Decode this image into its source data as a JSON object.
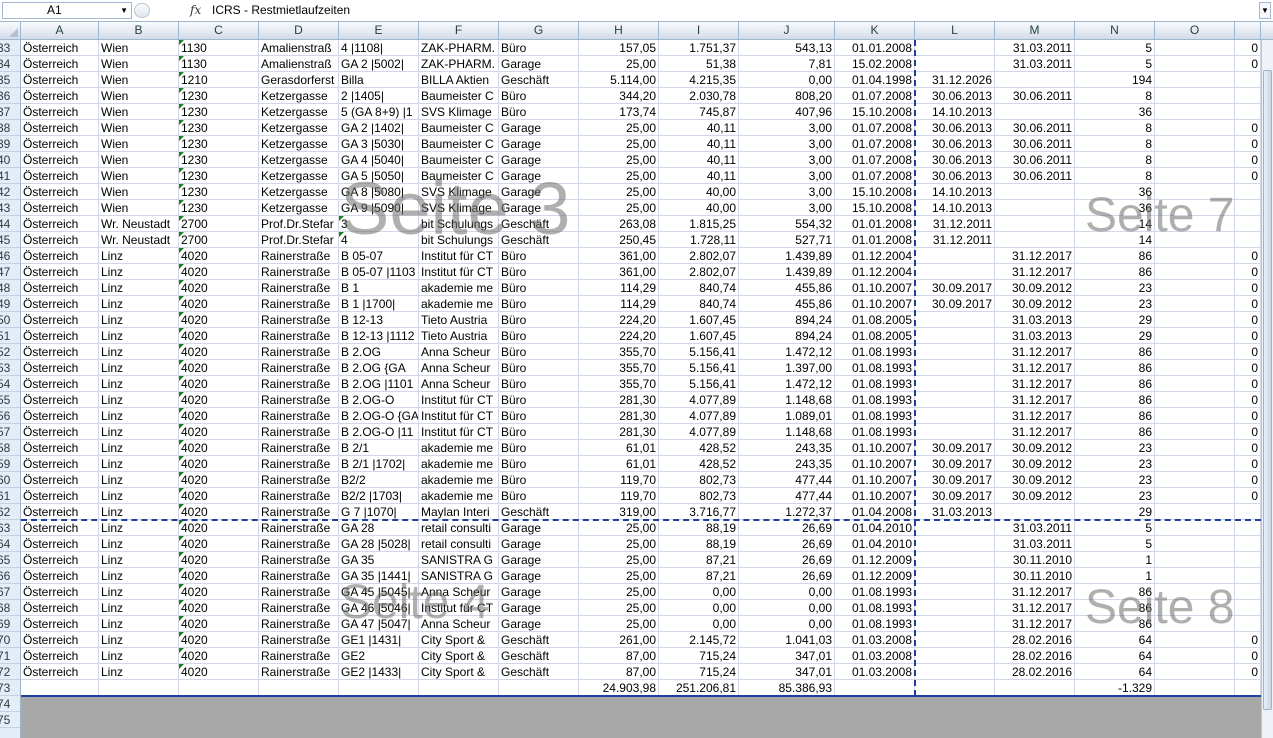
{
  "formula_bar": {
    "name_box": "A1",
    "fx_label": "fx",
    "formula": "ICRS - Restmietlaufzeiten"
  },
  "columns": [
    "A",
    "B",
    "C",
    "D",
    "E",
    "F",
    "G",
    "H",
    "I",
    "J",
    "K",
    "L",
    "M",
    "N",
    "O",
    ""
  ],
  "watermarks": {
    "page3": "Seite 3",
    "page4": "Seite 4",
    "page7": "Seite 7",
    "page8": "Seite 8"
  },
  "rows": [
    {
      "n": "33",
      "a": "Österreich",
      "b": "Wien",
      "c": "1130",
      "d": "Amalienstraß",
      "e": "4 |1108|",
      "f": "ZAK-PHARM.",
      "g": "Büro",
      "h": "157,05",
      "i": "1.751,37",
      "j": "543,13",
      "k": "01.01.2008",
      "l": "",
      "m": "31.03.2011",
      "nn": "5",
      "o": "",
      "p": "0"
    },
    {
      "n": "34",
      "a": "Österreich",
      "b": "Wien",
      "c": "1130",
      "d": "Amalienstraß",
      "e": "GA 2 |5002|",
      "f": "ZAK-PHARM.",
      "g": "Garage",
      "h": "25,00",
      "i": "51,38",
      "j": "7,81",
      "k": "15.02.2008",
      "l": "",
      "m": "31.03.2011",
      "nn": "5",
      "o": "",
      "p": "0"
    },
    {
      "n": "35",
      "a": "Österreich",
      "b": "Wien",
      "c": "1210",
      "d": "Gerasdorferst",
      "e": "Billa",
      "f": "BILLA Aktien",
      "g": "Geschäft",
      "h": "5.114,00",
      "i": "4.215,35",
      "j": "0,00",
      "k": "01.04.1998",
      "l": "31.12.2026",
      "m": "",
      "nn": "194",
      "o": "",
      "p": ""
    },
    {
      "n": "36",
      "a": "Österreich",
      "b": "Wien",
      "c": "1230",
      "d": "Ketzergasse",
      "e": "2 |1405|",
      "f": "Baumeister C",
      "g": "Büro",
      "h": "344,20",
      "i": "2.030,78",
      "j": "808,20",
      "k": "01.07.2008",
      "l": "30.06.2013",
      "m": "30.06.2011",
      "nn": "8",
      "o": "",
      "p": ""
    },
    {
      "n": "37",
      "a": "Österreich",
      "b": "Wien",
      "c": "1230",
      "d": "Ketzergasse",
      "e": "5 (GA 8+9) |1",
      "f": "SVS Klimage",
      "g": "Büro",
      "h": "173,74",
      "i": "745,87",
      "j": "407,96",
      "k": "15.10.2008",
      "l": "14.10.2013",
      "m": "",
      "nn": "36",
      "o": "",
      "p": ""
    },
    {
      "n": "38",
      "a": "Österreich",
      "b": "Wien",
      "c": "1230",
      "d": "Ketzergasse",
      "e": "GA 2 |1402|",
      "f": "Baumeister C",
      "g": "Garage",
      "h": "25,00",
      "i": "40,11",
      "j": "3,00",
      "k": "01.07.2008",
      "l": "30.06.2013",
      "m": "30.06.2011",
      "nn": "8",
      "o": "",
      "p": "0"
    },
    {
      "n": "39",
      "a": "Österreich",
      "b": "Wien",
      "c": "1230",
      "d": "Ketzergasse",
      "e": "GA 3 |5030|",
      "f": "Baumeister C",
      "g": "Garage",
      "h": "25,00",
      "i": "40,11",
      "j": "3,00",
      "k": "01.07.2008",
      "l": "30.06.2013",
      "m": "30.06.2011",
      "nn": "8",
      "o": "",
      "p": "0"
    },
    {
      "n": "40",
      "a": "Österreich",
      "b": "Wien",
      "c": "1230",
      "d": "Ketzergasse",
      "e": "GA 4 |5040|",
      "f": "Baumeister C",
      "g": "Garage",
      "h": "25,00",
      "i": "40,11",
      "j": "3,00",
      "k": "01.07.2008",
      "l": "30.06.2013",
      "m": "30.06.2011",
      "nn": "8",
      "o": "",
      "p": "0"
    },
    {
      "n": "41",
      "a": "Österreich",
      "b": "Wien",
      "c": "1230",
      "d": "Ketzergasse",
      "e": "GA 5 |5050|",
      "f": "Baumeister C",
      "g": "Garage",
      "h": "25,00",
      "i": "40,11",
      "j": "3,00",
      "k": "01.07.2008",
      "l": "30.06.2013",
      "m": "30.06.2011",
      "nn": "8",
      "o": "",
      "p": "0"
    },
    {
      "n": "42",
      "a": "Österreich",
      "b": "Wien",
      "c": "1230",
      "d": "Ketzergasse",
      "e": "GA 8 |5080|",
      "f": "SVS Klimage",
      "g": "Garage",
      "h": "25,00",
      "i": "40,00",
      "j": "3,00",
      "k": "15.10.2008",
      "l": "14.10.2013",
      "m": "",
      "nn": "36",
      "o": "",
      "p": ""
    },
    {
      "n": "43",
      "a": "Österreich",
      "b": "Wien",
      "c": "1230",
      "d": "Ketzergasse",
      "e": "GA 9 |5090|",
      "f": "SVS Klimage",
      "g": "Garage",
      "h": "25,00",
      "i": "40,00",
      "j": "3,00",
      "k": "15.10.2008",
      "l": "14.10.2013",
      "m": "",
      "nn": "36",
      "o": "",
      "p": ""
    },
    {
      "n": "44",
      "a": "Österreich",
      "b": "Wr. Neustadt",
      "c": "2700",
      "d": "Prof.Dr.Stefar",
      "e": "3",
      "f": "bit Schulungs",
      "g": "Geschäft",
      "h": "263,08",
      "i": "1.815,25",
      "j": "554,32",
      "k": "01.01.2008",
      "l": "31.12.2011",
      "m": "",
      "nn": "14",
      "o": "",
      "p": ""
    },
    {
      "n": "45",
      "a": "Österreich",
      "b": "Wr. Neustadt",
      "c": "2700",
      "d": "Prof.Dr.Stefar",
      "e": "4",
      "f": "bit Schulungs",
      "g": "Geschäft",
      "h": "250,45",
      "i": "1.728,11",
      "j": "527,71",
      "k": "01.01.2008",
      "l": "31.12.2011",
      "m": "",
      "nn": "14",
      "o": "",
      "p": ""
    },
    {
      "n": "46",
      "a": "Österreich",
      "b": "Linz",
      "c": "4020",
      "d": "Rainerstraße",
      "e": "B 05-07",
      "f": "Institut für CT",
      "g": "Büro",
      "h": "361,00",
      "i": "2.802,07",
      "j": "1.439,89",
      "k": "01.12.2004",
      "l": "",
      "m": "31.12.2017",
      "nn": "86",
      "o": "",
      "p": "0"
    },
    {
      "n": "47",
      "a": "Österreich",
      "b": "Linz",
      "c": "4020",
      "d": "Rainerstraße",
      "e": "B 05-07 |1103",
      "f": "Institut für CT",
      "g": "Büro",
      "h": "361,00",
      "i": "2.802,07",
      "j": "1.439,89",
      "k": "01.12.2004",
      "l": "",
      "m": "31.12.2017",
      "nn": "86",
      "o": "",
      "p": "0"
    },
    {
      "n": "48",
      "a": "Österreich",
      "b": "Linz",
      "c": "4020",
      "d": "Rainerstraße",
      "e": "B 1",
      "f": "akademie me",
      "g": "Büro",
      "h": "114,29",
      "i": "840,74",
      "j": "455,86",
      "k": "01.10.2007",
      "l": "30.09.2017",
      "m": "30.09.2012",
      "nn": "23",
      "o": "",
      "p": "0"
    },
    {
      "n": "49",
      "a": "Österreich",
      "b": "Linz",
      "c": "4020",
      "d": "Rainerstraße",
      "e": "B 1 |1700|",
      "f": "akademie me",
      "g": "Büro",
      "h": "114,29",
      "i": "840,74",
      "j": "455,86",
      "k": "01.10.2007",
      "l": "30.09.2017",
      "m": "30.09.2012",
      "nn": "23",
      "o": "",
      "p": "0"
    },
    {
      "n": "50",
      "a": "Österreich",
      "b": "Linz",
      "c": "4020",
      "d": "Rainerstraße",
      "e": "B 12-13",
      "f": "Tieto Austria",
      "g": "Büro",
      "h": "224,20",
      "i": "1.607,45",
      "j": "894,24",
      "k": "01.08.2005",
      "l": "",
      "m": "31.03.2013",
      "nn": "29",
      "o": "",
      "p": "0"
    },
    {
      "n": "51",
      "a": "Österreich",
      "b": "Linz",
      "c": "4020",
      "d": "Rainerstraße",
      "e": "B 12-13 |1112",
      "f": "Tieto Austria",
      "g": "Büro",
      "h": "224,20",
      "i": "1.607,45",
      "j": "894,24",
      "k": "01.08.2005",
      "l": "",
      "m": "31.03.2013",
      "nn": "29",
      "o": "",
      "p": "0"
    },
    {
      "n": "52",
      "a": "Österreich",
      "b": "Linz",
      "c": "4020",
      "d": "Rainerstraße",
      "e": "B 2.OG",
      "f": "Anna Scheur",
      "g": "Büro",
      "h": "355,70",
      "i": "5.156,41",
      "j": "1.472,12",
      "k": "01.08.1993",
      "l": "",
      "m": "31.12.2017",
      "nn": "86",
      "o": "",
      "p": "0"
    },
    {
      "n": "53",
      "a": "Österreich",
      "b": "Linz",
      "c": "4020",
      "d": "Rainerstraße",
      "e": "B 2.OG {GA",
      "f": "Anna Scheur",
      "g": "Büro",
      "h": "355,70",
      "i": "5.156,41",
      "j": "1.397,00",
      "k": "01.08.1993",
      "l": "",
      "m": "31.12.2017",
      "nn": "86",
      "o": "",
      "p": "0"
    },
    {
      "n": "54",
      "a": "Österreich",
      "b": "Linz",
      "c": "4020",
      "d": "Rainerstraße",
      "e": "B 2.OG |1101",
      "f": "Anna Scheur",
      "g": "Büro",
      "h": "355,70",
      "i": "5.156,41",
      "j": "1.472,12",
      "k": "01.08.1993",
      "l": "",
      "m": "31.12.2017",
      "nn": "86",
      "o": "",
      "p": "0"
    },
    {
      "n": "55",
      "a": "Österreich",
      "b": "Linz",
      "c": "4020",
      "d": "Rainerstraße",
      "e": "B 2.OG-O",
      "f": "Institut für CT",
      "g": "Büro",
      "h": "281,30",
      "i": "4.077,89",
      "j": "1.148,68",
      "k": "01.08.1993",
      "l": "",
      "m": "31.12.2017",
      "nn": "86",
      "o": "",
      "p": "0"
    },
    {
      "n": "56",
      "a": "Österreich",
      "b": "Linz",
      "c": "4020",
      "d": "Rainerstraße",
      "e": "B 2.OG-O {GA",
      "f": "Institut für CT",
      "g": "Büro",
      "h": "281,30",
      "i": "4.077,89",
      "j": "1.089,01",
      "k": "01.08.1993",
      "l": "",
      "m": "31.12.2017",
      "nn": "86",
      "o": "",
      "p": "0"
    },
    {
      "n": "57",
      "a": "Österreich",
      "b": "Linz",
      "c": "4020",
      "d": "Rainerstraße",
      "e": "B 2.OG-O |11",
      "f": "Institut für CT",
      "g": "Büro",
      "h": "281,30",
      "i": "4.077,89",
      "j": "1.148,68",
      "k": "01.08.1993",
      "l": "",
      "m": "31.12.2017",
      "nn": "86",
      "o": "",
      "p": "0"
    },
    {
      "n": "58",
      "a": "Österreich",
      "b": "Linz",
      "c": "4020",
      "d": "Rainerstraße",
      "e": "B 2/1",
      "f": "akademie me",
      "g": "Büro",
      "h": "61,01",
      "i": "428,52",
      "j": "243,35",
      "k": "01.10.2007",
      "l": "30.09.2017",
      "m": "30.09.2012",
      "nn": "23",
      "o": "",
      "p": "0"
    },
    {
      "n": "59",
      "a": "Österreich",
      "b": "Linz",
      "c": "4020",
      "d": "Rainerstraße",
      "e": "B 2/1 |1702|",
      "f": "akademie me",
      "g": "Büro",
      "h": "61,01",
      "i": "428,52",
      "j": "243,35",
      "k": "01.10.2007",
      "l": "30.09.2017",
      "m": "30.09.2012",
      "nn": "23",
      "o": "",
      "p": "0"
    },
    {
      "n": "60",
      "a": "Österreich",
      "b": "Linz",
      "c": "4020",
      "d": "Rainerstraße",
      "e": "B2/2",
      "f": "akademie me",
      "g": "Büro",
      "h": "119,70",
      "i": "802,73",
      "j": "477,44",
      "k": "01.10.2007",
      "l": "30.09.2017",
      "m": "30.09.2012",
      "nn": "23",
      "o": "",
      "p": "0"
    },
    {
      "n": "61",
      "a": "Österreich",
      "b": "Linz",
      "c": "4020",
      "d": "Rainerstraße",
      "e": "B2/2 |1703|",
      "f": "akademie me",
      "g": "Büro",
      "h": "119,70",
      "i": "802,73",
      "j": "477,44",
      "k": "01.10.2007",
      "l": "30.09.2017",
      "m": "30.09.2012",
      "nn": "23",
      "o": "",
      "p": "0"
    },
    {
      "n": "62",
      "a": "Österreich",
      "b": "Linz",
      "c": "4020",
      "d": "Rainerstraße",
      "e": "G 7 |1070|",
      "f": "Maylan Interi",
      "g": "Geschäft",
      "h": "319,00",
      "i": "3.716,77",
      "j": "1.272,37",
      "k": "01.04.2008",
      "l": "31.03.2013",
      "m": "",
      "nn": "29",
      "o": "",
      "p": ""
    },
    {
      "n": "63",
      "a": "Österreich",
      "b": "Linz",
      "c": "4020",
      "d": "Rainerstraße",
      "e": "GA 28",
      "f": "retail consulti",
      "g": "Garage",
      "h": "25,00",
      "i": "88,19",
      "j": "26,69",
      "k": "01.04.2010",
      "l": "",
      "m": "31.03.2011",
      "nn": "5",
      "o": "",
      "p": ""
    },
    {
      "n": "64",
      "a": "Österreich",
      "b": "Linz",
      "c": "4020",
      "d": "Rainerstraße",
      "e": "GA 28 |5028|",
      "f": "retail consulti",
      "g": "Garage",
      "h": "25,00",
      "i": "88,19",
      "j": "26,69",
      "k": "01.04.2010",
      "l": "",
      "m": "31.03.2011",
      "nn": "5",
      "o": "",
      "p": ""
    },
    {
      "n": "65",
      "a": "Österreich",
      "b": "Linz",
      "c": "4020",
      "d": "Rainerstraße",
      "e": "GA 35",
      "f": "SANISTRA G",
      "g": "Garage",
      "h": "25,00",
      "i": "87,21",
      "j": "26,69",
      "k": "01.12.2009",
      "l": "",
      "m": "30.11.2010",
      "nn": "1",
      "o": "",
      "p": ""
    },
    {
      "n": "66",
      "a": "Österreich",
      "b": "Linz",
      "c": "4020",
      "d": "Rainerstraße",
      "e": "GA 35 |1441|",
      "f": "SANISTRA G",
      "g": "Garage",
      "h": "25,00",
      "i": "87,21",
      "j": "26,69",
      "k": "01.12.2009",
      "l": "",
      "m": "30.11.2010",
      "nn": "1",
      "o": "",
      "p": ""
    },
    {
      "n": "67",
      "a": "Österreich",
      "b": "Linz",
      "c": "4020",
      "d": "Rainerstraße",
      "e": "GA 45 |5045|",
      "f": "Anna Scheur",
      "g": "Garage",
      "h": "25,00",
      "i": "0,00",
      "j": "0,00",
      "k": "01.08.1993",
      "l": "",
      "m": "31.12.2017",
      "nn": "86",
      "o": "",
      "p": ""
    },
    {
      "n": "68",
      "a": "Österreich",
      "b": "Linz",
      "c": "4020",
      "d": "Rainerstraße",
      "e": "GA 46 |5046|",
      "f": "Institut für CT",
      "g": "Garage",
      "h": "25,00",
      "i": "0,00",
      "j": "0,00",
      "k": "01.08.1993",
      "l": "",
      "m": "31.12.2017",
      "nn": "86",
      "o": "",
      "p": ""
    },
    {
      "n": "69",
      "a": "Österreich",
      "b": "Linz",
      "c": "4020",
      "d": "Rainerstraße",
      "e": "GA 47 |5047|",
      "f": "Anna Scheur",
      "g": "Garage",
      "h": "25,00",
      "i": "0,00",
      "j": "0,00",
      "k": "01.08.1993",
      "l": "",
      "m": "31.12.2017",
      "nn": "86",
      "o": "",
      "p": ""
    },
    {
      "n": "70",
      "a": "Österreich",
      "b": "Linz",
      "c": "4020",
      "d": "Rainerstraße",
      "e": "GE1 |1431|",
      "f": "City Sport & ",
      "g": "Geschäft",
      "h": "261,00",
      "i": "2.145,72",
      "j": "1.041,03",
      "k": "01.03.2008",
      "l": "",
      "m": "28.02.2016",
      "nn": "64",
      "o": "",
      "p": "0"
    },
    {
      "n": "71",
      "a": "Österreich",
      "b": "Linz",
      "c": "4020",
      "d": "Rainerstraße",
      "e": "GE2",
      "f": "City Sport & ",
      "g": "Geschäft",
      "h": "87,00",
      "i": "715,24",
      "j": "347,01",
      "k": "01.03.2008",
      "l": "",
      "m": "28.02.2016",
      "nn": "64",
      "o": "",
      "p": "0"
    },
    {
      "n": "72",
      "a": "Österreich",
      "b": "Linz",
      "c": "4020",
      "d": "Rainerstraße",
      "e": "GE2 |1433|",
      "f": "City Sport & ",
      "g": "Geschäft",
      "h": "87,00",
      "i": "715,24",
      "j": "347,01",
      "k": "01.03.2008",
      "l": "",
      "m": "28.02.2016",
      "nn": "64",
      "o": "",
      "p": "0"
    },
    {
      "n": "73",
      "a": "",
      "b": "",
      "c": "",
      "d": "",
      "e": "",
      "f": "",
      "g": "",
      "h": "24.903,98",
      "i": "251.206,81",
      "j": "85.386,93",
      "k": "",
      "l": "",
      "m": "",
      "nn": "-1.329",
      "o": "",
      "p": ""
    }
  ],
  "empty_rows": [
    "74",
    "75"
  ]
}
